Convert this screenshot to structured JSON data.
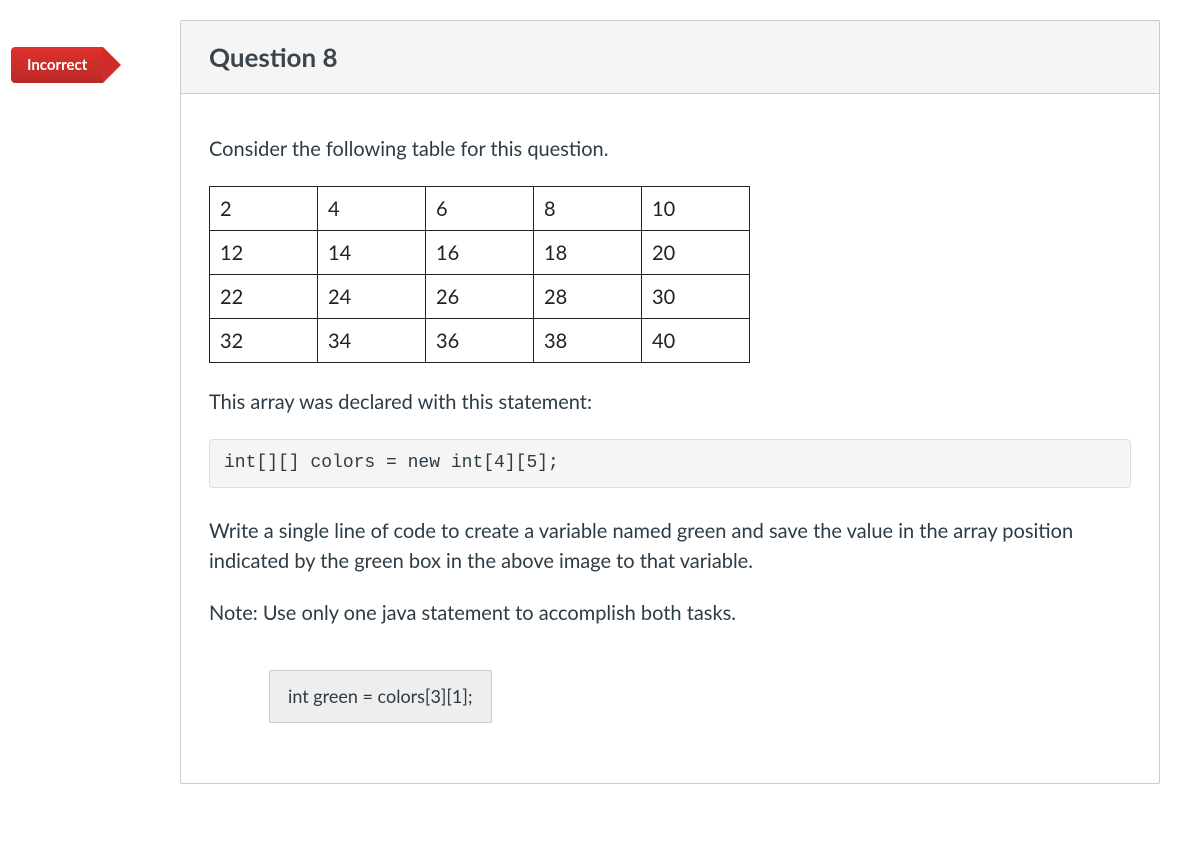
{
  "status": "Incorrect",
  "title": "Question 8",
  "prompt1": "Consider the following table for this question.",
  "table": {
    "rows": [
      [
        {
          "v": "2",
          "cls": "blue"
        },
        {
          "v": "4",
          "cls": ""
        },
        {
          "v": "6",
          "cls": ""
        },
        {
          "v": "8",
          "cls": ""
        },
        {
          "v": "10",
          "cls": ""
        }
      ],
      [
        {
          "v": "12",
          "cls": ""
        },
        {
          "v": "14",
          "cls": ""
        },
        {
          "v": "16",
          "cls": ""
        },
        {
          "v": "18",
          "cls": "red"
        },
        {
          "v": "20",
          "cls": ""
        }
      ],
      [
        {
          "v": "22",
          "cls": ""
        },
        {
          "v": "24",
          "cls": ""
        },
        {
          "v": "26",
          "cls": ""
        },
        {
          "v": "28",
          "cls": ""
        },
        {
          "v": "30",
          "cls": ""
        }
      ],
      [
        {
          "v": "32",
          "cls": ""
        },
        {
          "v": "34",
          "cls": "green"
        },
        {
          "v": "36",
          "cls": ""
        },
        {
          "v": "38",
          "cls": ""
        },
        {
          "v": "40",
          "cls": ""
        }
      ]
    ]
  },
  "prompt2": "This array was declared with this statement:",
  "code": "int[][] colors = new int[4][5];",
  "prompt3": "Write a single line of code to create a variable named green and save the value in the array position indicated by the green box in the above image to that variable.",
  "prompt4": "Note: Use only one java statement to accomplish both tasks.",
  "answer": "int green = colors[3][1];"
}
